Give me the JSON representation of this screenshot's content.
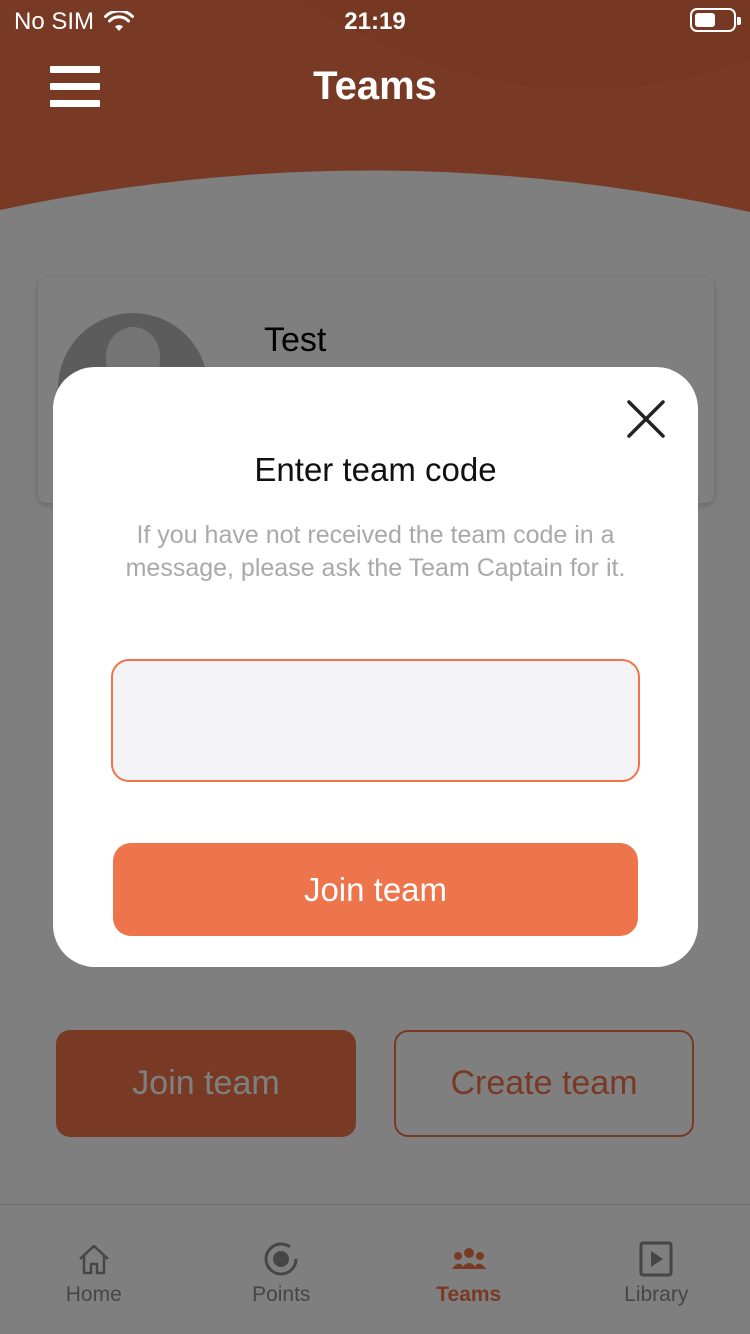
{
  "status_bar": {
    "carrier": "No SIM",
    "time": "21:19"
  },
  "header": {
    "title": "Teams"
  },
  "team_card": {
    "name": "Test"
  },
  "actions": {
    "join_label": "Join team",
    "create_label": "Create team"
  },
  "tabbar": {
    "items": [
      {
        "label": "Home",
        "icon": "home-icon"
      },
      {
        "label": "Points",
        "icon": "target-icon"
      },
      {
        "label": "Teams",
        "icon": "team-icon",
        "active": true
      },
      {
        "label": "Library",
        "icon": "play-square-icon"
      }
    ]
  },
  "modal": {
    "title": "Enter team code",
    "description": "If you have not received the team code in a message, please ask the Team Captain for it.",
    "input_value": "",
    "join_label": "Join team"
  },
  "colors": {
    "accent": "#f0744a",
    "header_bg": "#f0744a",
    "overlay": "rgba(0,0,0,0.5)"
  }
}
